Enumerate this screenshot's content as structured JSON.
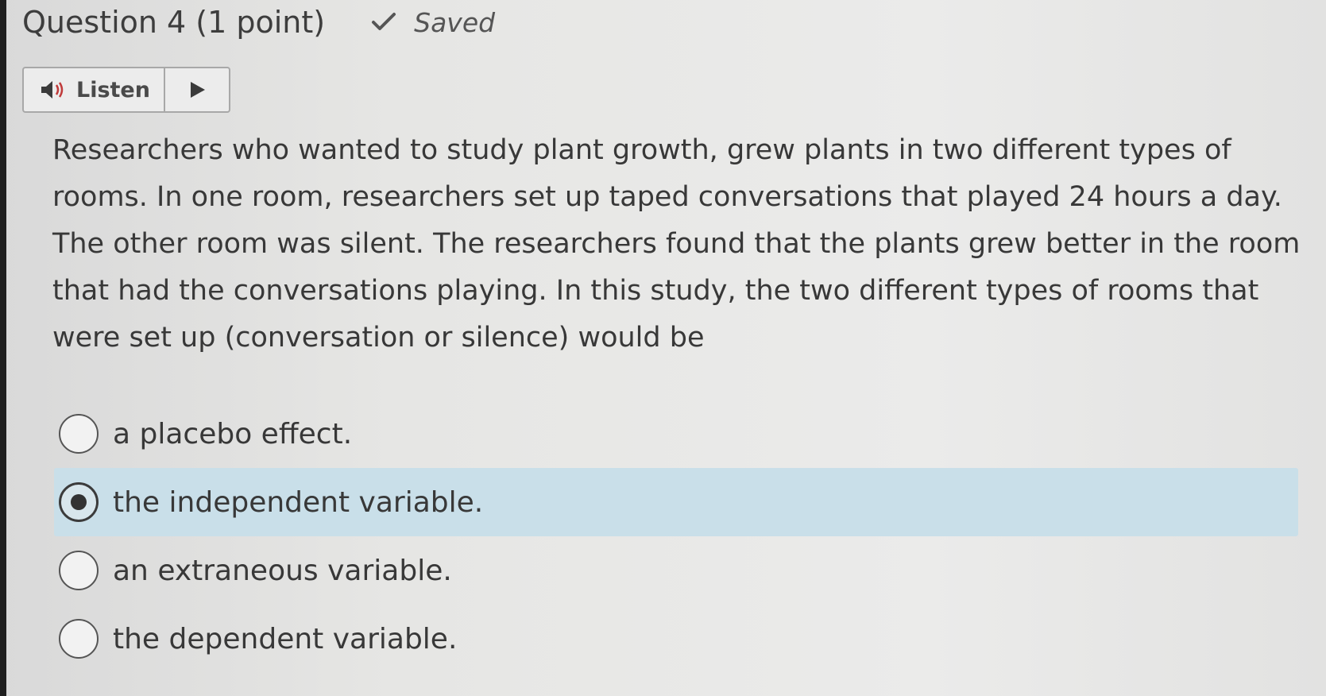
{
  "header": {
    "question_title": "Question 4 (1 point)",
    "status": "Saved",
    "status_icon": "checkmark-icon"
  },
  "listen": {
    "label": "Listen",
    "speaker_icon": "speaker-icon",
    "play_icon": "play-icon"
  },
  "question": {
    "text": "Researchers who wanted to study plant growth, grew plants in two different types of rooms. In one room, researchers set up taped conversations that played 24 hours a day. The other room was silent. The researchers found that the plants grew better in the room that had the conversations playing. In this study, the two different types of rooms that were set up (conversation or silence) would be"
  },
  "options": [
    {
      "label": "a placebo effect.",
      "selected": false
    },
    {
      "label": "the independent variable.",
      "selected": true
    },
    {
      "label": "an extraneous variable.",
      "selected": false
    },
    {
      "label": "the dependent variable.",
      "selected": false
    }
  ],
  "colors": {
    "selected_background": "#c9dfe9",
    "text": "#383838"
  }
}
